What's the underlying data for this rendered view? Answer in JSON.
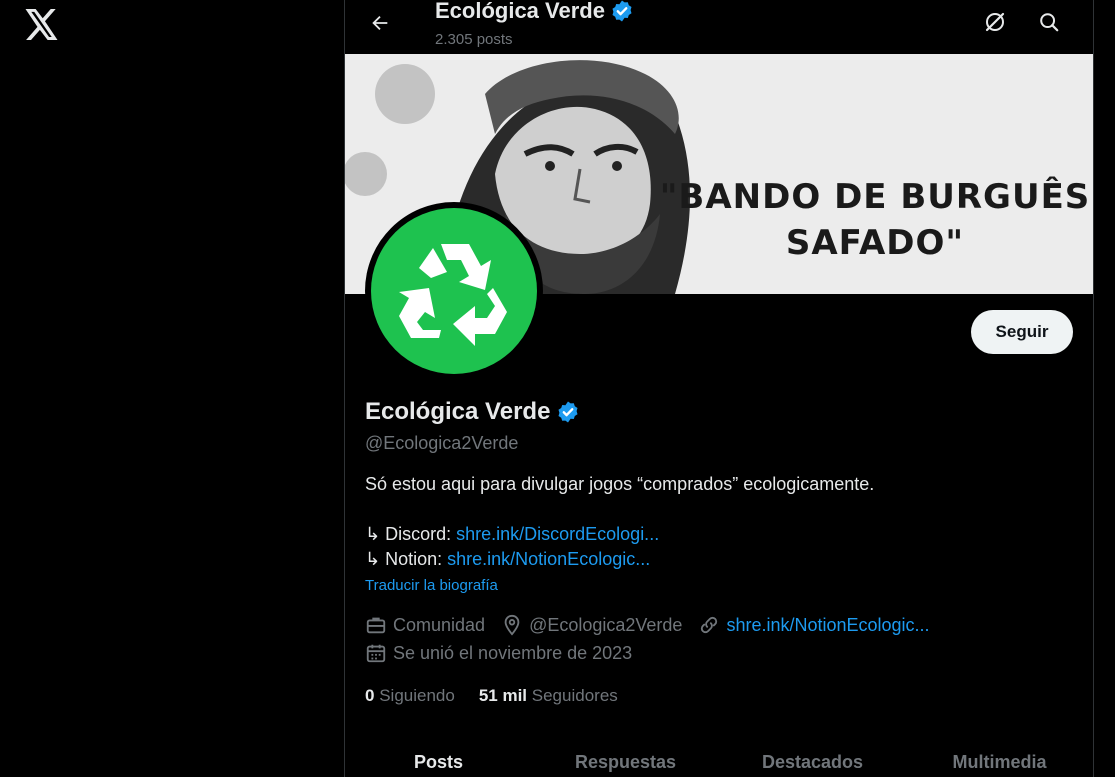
{
  "header": {
    "title": "Ecológica Verde",
    "posts_count": "2.305 posts"
  },
  "banner": {
    "quote_line1": "\"BANDO DE BURGUÊS",
    "quote_line2": "SAFADO\""
  },
  "profile": {
    "follow_label": "Seguir",
    "name": "Ecológica Verde",
    "handle": "@Ecologica2Verde",
    "bio": "Só estou aqui para divulgar jogos “comprados” ecologicamente.",
    "bio_links": [
      {
        "prefix": "↳ Discord: ",
        "link": "shre.ink/DiscordEcologi..."
      },
      {
        "prefix": "↳ Notion: ",
        "link": "shre.ink/NotionEcologic..."
      }
    ],
    "translate_label": "Traducir la biografía",
    "meta": {
      "category": "Comunidad",
      "location": "@Ecologica2Verde",
      "website": "shre.ink/NotionEcologic...",
      "joined": "Se unió el noviembre de 2023"
    },
    "stats": {
      "following_count": "0",
      "following_label": "Siguiendo",
      "followers_count": "51 mil",
      "followers_label": "Seguidores"
    }
  },
  "tabs": [
    {
      "label": "Posts",
      "active": true
    },
    {
      "label": "Respuestas",
      "active": false
    },
    {
      "label": "Destacados",
      "active": false
    },
    {
      "label": "Multimedia",
      "active": false
    }
  ],
  "colors": {
    "accent": "#1d9bf0",
    "avatar_green": "#1ec24f",
    "background": "#000000",
    "muted_text": "#71767b"
  },
  "icons": {
    "logo": "x-logo-icon",
    "back": "arrow-left-icon",
    "grok": "grok-icon",
    "search": "search-icon",
    "verified": "verified-badge-icon",
    "category": "briefcase-icon",
    "location": "location-pin-icon",
    "website": "link-icon",
    "joined": "calendar-icon",
    "avatar": "recycle-icon"
  }
}
